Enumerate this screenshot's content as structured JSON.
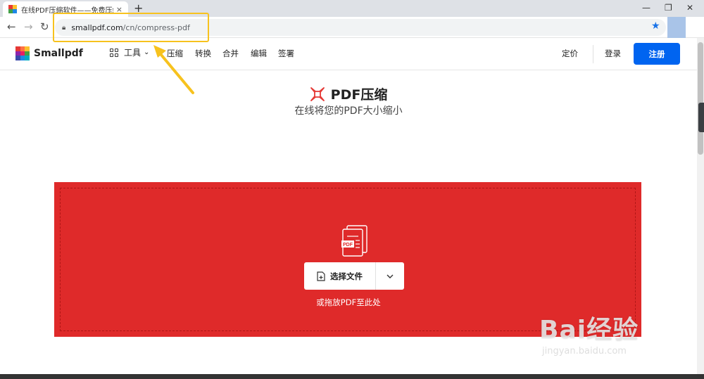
{
  "browser": {
    "tab_title": "在线PDF压缩软件——免费压缩",
    "tab_close": "×",
    "new_tab": "+",
    "url_host": "smallpdf.com",
    "url_path": "/cn/compress-pdf",
    "window_min": "—",
    "window_restore": "❐",
    "window_close": "✕"
  },
  "header": {
    "logo_text": "Smallpdf",
    "nav": {
      "tools": "工具",
      "compress": "压缩",
      "convert": "转换",
      "merge": "合并",
      "edit": "编辑",
      "sign": "签署"
    },
    "pricing": "定价",
    "login": "登录",
    "signup": "注册"
  },
  "hero": {
    "title": "PDF压缩",
    "subtitle": "在线将您的PDF大小缩小"
  },
  "dropzone": {
    "choose_file": "选择文件",
    "file_badge": "PDF",
    "hint": "或拖放PDF至此处"
  },
  "watermark": {
    "brand": "Bai经验",
    "url": "jingyan.baidu.com"
  },
  "colors": {
    "accent": "#0064f0",
    "dropzone": "#df2a2a",
    "highlight": "#f7c21e"
  }
}
